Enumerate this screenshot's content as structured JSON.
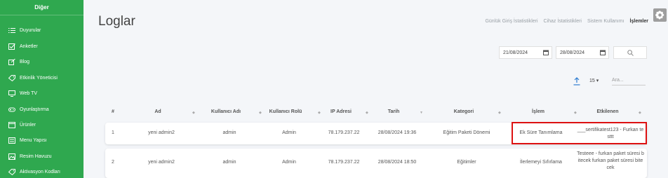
{
  "sidebar": {
    "header": "Diğer",
    "items": [
      {
        "label": "Duyurular",
        "icon": "list-icon"
      },
      {
        "label": "Anketler",
        "icon": "checkbox-icon"
      },
      {
        "label": "Blog",
        "icon": "edit-icon"
      },
      {
        "label": "Etkinlik Yöneticisi",
        "icon": "tag-icon"
      },
      {
        "label": "Web TV",
        "icon": "monitor-icon"
      },
      {
        "label": "Oyunlaştırma",
        "icon": "gamepad-icon"
      },
      {
        "label": "Ürünler",
        "icon": "box-icon"
      },
      {
        "label": "Menu Yapısı",
        "icon": "menu-icon"
      },
      {
        "label": "Resim Havuzu",
        "icon": "image-icon"
      },
      {
        "label": "Aktivasyon Kodları",
        "icon": "tag-icon"
      }
    ]
  },
  "page": {
    "title": "Loglar"
  },
  "tabs": [
    {
      "label": "Günlük Giriş İstatistikleri",
      "active": false
    },
    {
      "label": "Cihaz İstatistikleri",
      "active": false
    },
    {
      "label": "Sistem Kullanımı",
      "active": false
    },
    {
      "label": "İşlemler",
      "active": true
    }
  ],
  "filters": {
    "start_date": "21/08/2024",
    "end_date": "28/08/2024"
  },
  "table_controls": {
    "page_size": "15",
    "search_placeholder": "Ara..."
  },
  "table": {
    "columns": [
      "#",
      "Ad",
      "Kullanıcı Adı",
      "Kullanıcı Rolü",
      "IP Adresi",
      "Tarih",
      "Kategori",
      "İşlem",
      "Etkilenen"
    ],
    "rows": [
      {
        "no": "1",
        "ad": "yeni admin2",
        "kullanici_adi": "admin",
        "rol": "Admin",
        "ip": "78.179.237.22",
        "tarih": "28/08/2024 19:36",
        "kategori": "Eğitim Paketi Dönemi",
        "islem": "Ek Süre Tanımlama",
        "etkilenen": "___sertifikatest123 - Furkan testtt"
      },
      {
        "no": "2",
        "ad": "yeni admin2",
        "kullanici_adi": "admin",
        "rol": "Admin",
        "ip": "78.179.237.22",
        "tarih": "28/08/2024 18:50",
        "kategori": "Eğitimler",
        "islem": "İlerlemeyi Sıfırlama",
        "etkilenen": "Testeee - furkan paket süresi bitecek furkan paket süresi bitecek"
      }
    ]
  },
  "colors": {
    "sidebar": "#2fa84f",
    "highlight": "#dd1111"
  }
}
